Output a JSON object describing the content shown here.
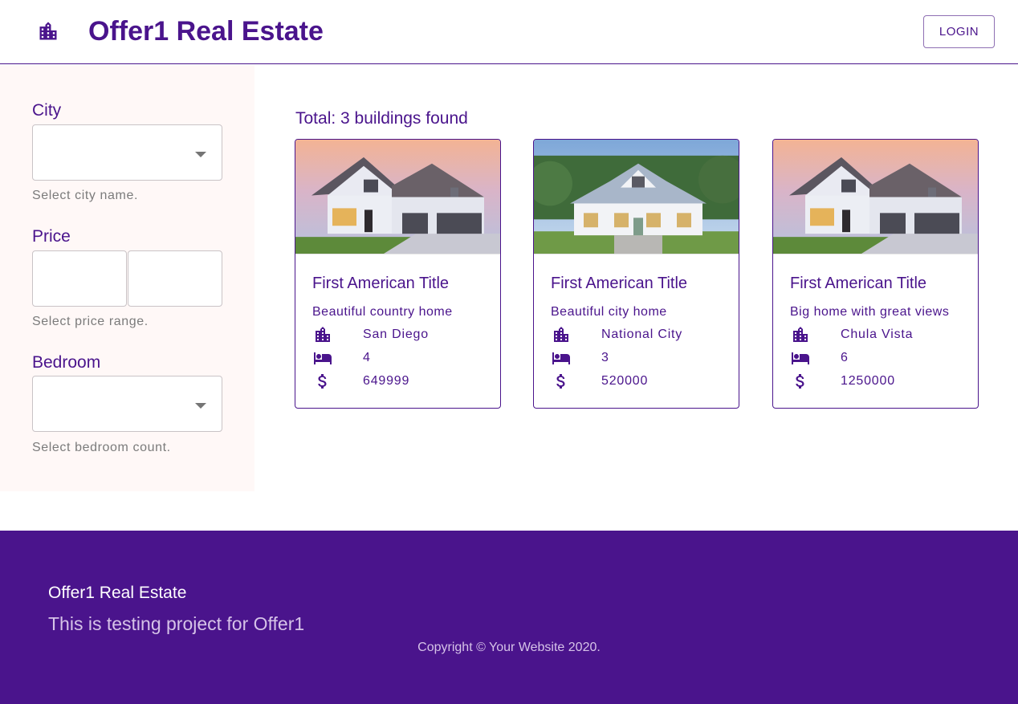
{
  "header": {
    "brand_icon": "building-icon",
    "title": "Offer1 Real Estate",
    "login_label": "LOGIN"
  },
  "colors": {
    "primary": "#4a148c",
    "sidebar_bg": "#fff8f7",
    "footer_text_muted": "#d6c3e8"
  },
  "filters": {
    "city": {
      "label": "City",
      "value": "",
      "helper": "Select city name."
    },
    "price": {
      "label": "Price",
      "min_value": "",
      "max_value": "",
      "helper": "Select price range."
    },
    "bedroom": {
      "label": "Bedroom",
      "value": "",
      "helper": "Select bedroom count."
    }
  },
  "results": {
    "total_text": "Total: 3 buildings found"
  },
  "listings": [
    {
      "image": "house-photo-1",
      "title": "First American Title",
      "description": "Beautiful country home",
      "city": "San Diego",
      "bedrooms": "4",
      "price": "649999"
    },
    {
      "image": "house-photo-2",
      "title": "First American Title",
      "description": "Beautiful city home",
      "city": "National City",
      "bedrooms": "3",
      "price": "520000"
    },
    {
      "image": "house-photo-3",
      "title": "First American Title",
      "description": "Big home with great views",
      "city": "Chula Vista",
      "bedrooms": "6",
      "price": "1250000"
    }
  ],
  "card_icons": {
    "city": "building-icon",
    "bedrooms": "bed-icon",
    "price": "dollar-icon"
  },
  "footer": {
    "title": "Offer1 Real Estate",
    "subtitle": "This is testing project for Offer1",
    "copyright": "Copyright © Your Website 2020."
  }
}
